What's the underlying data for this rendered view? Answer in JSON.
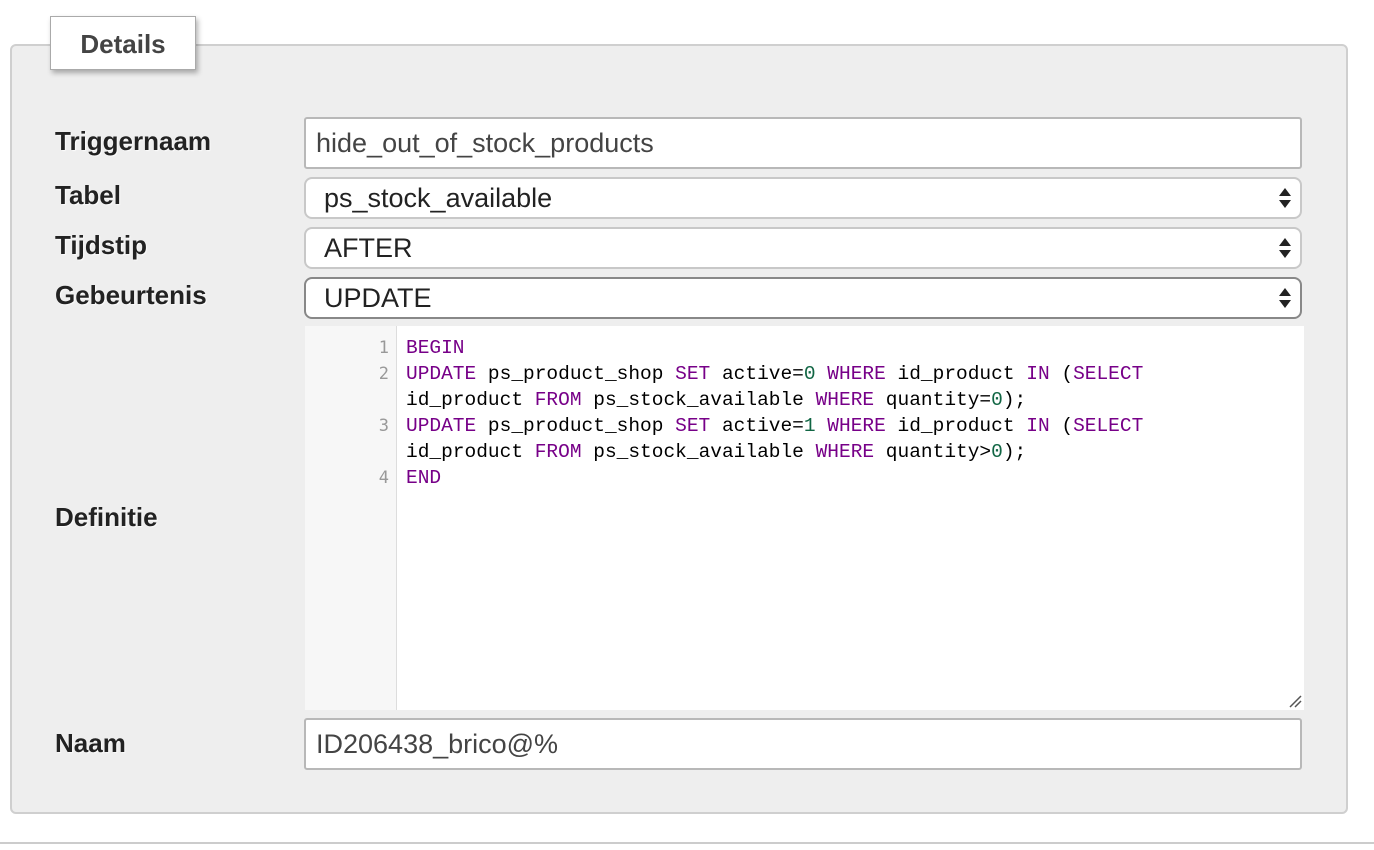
{
  "fieldset": {
    "legend": "Details"
  },
  "form": {
    "triggername": {
      "label": "Triggernaam",
      "value": "hide_out_of_stock_products"
    },
    "table": {
      "label": "Tabel",
      "selected": "ps_stock_available"
    },
    "timing": {
      "label": "Tijdstip",
      "selected": "AFTER"
    },
    "event": {
      "label": "Gebeurtenis",
      "selected": "UPDATE"
    },
    "definition": {
      "label": "Definitie",
      "line_numbers": [
        "1",
        "2",
        "3",
        "4"
      ],
      "tokens": {
        "l1_begin": "BEGIN",
        "l2_update": "UPDATE",
        "l2_t1": " ps_product_shop ",
        "l2_set": "SET",
        "l2_t2": " active=",
        "l2_n1": "0",
        "l2_t3": " ",
        "l2_where": "WHERE",
        "l2_t4": " id_product ",
        "l2_in": "IN",
        "l2_t5": " (",
        "l2_select": "SELECT",
        "l2b_t1": "id_product ",
        "l2b_from": "FROM",
        "l2b_t2": " ps_stock_available ",
        "l2b_where": "WHERE",
        "l2b_t3": " quantity=",
        "l2b_n1": "0",
        "l2b_t4": ");",
        "l3_update": "UPDATE",
        "l3_t1": " ps_product_shop ",
        "l3_set": "SET",
        "l3_t2": " active=",
        "l3_n1": "1",
        "l3_t3": " ",
        "l3_where": "WHERE",
        "l3_t4": " id_product ",
        "l3_in": "IN",
        "l3_t5": " (",
        "l3_select": "SELECT",
        "l3b_t1": "id_product ",
        "l3b_from": "FROM",
        "l3b_t2": " ps_stock_available ",
        "l3b_where": "WHERE",
        "l3b_t3": " quantity>",
        "l3b_n1": "0",
        "l3b_t4": ");",
        "l4_end": "END"
      }
    },
    "definer": {
      "label": "Naam",
      "value": "ID206438_brico@%"
    }
  },
  "colors": {
    "keyword": "#770088",
    "number": "#116644",
    "panel_background": "#eeeeee"
  },
  "icons": [
    "select-arrows-icon",
    "resize-grip-icon"
  ]
}
